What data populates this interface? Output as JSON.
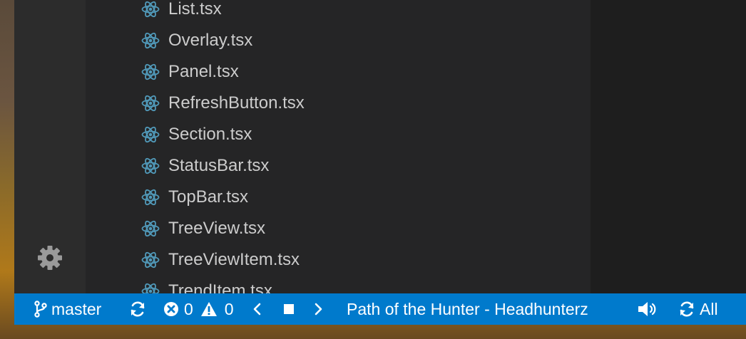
{
  "files": [
    {
      "name": "List.tsx"
    },
    {
      "name": "Overlay.tsx"
    },
    {
      "name": "Panel.tsx"
    },
    {
      "name": "RefreshButton.tsx"
    },
    {
      "name": "Section.tsx"
    },
    {
      "name": "StatusBar.tsx"
    },
    {
      "name": "TopBar.tsx"
    },
    {
      "name": "TreeView.tsx"
    },
    {
      "name": "TreeViewItem.tsx"
    },
    {
      "name": "TrendItem.tsx"
    }
  ],
  "status_bar": {
    "branch": "master",
    "errors": "0",
    "warnings": "0",
    "track": "Path of the Hunter - Headhunterz",
    "sync_label": "All"
  },
  "icons": {
    "file": "react-icon",
    "settings": "gear-icon",
    "branch": "git-branch-icon",
    "sync": "sync-icon",
    "errors": "error-icon",
    "warnings": "warning-icon",
    "prev": "chevron-left-icon",
    "stop": "stop-icon",
    "next": "chevron-right-icon",
    "volume": "volume-icon",
    "sync_all": "sync-all-icon"
  },
  "colors": {
    "status_bar": "#007acc",
    "sidebar": "#252526",
    "activity_bar": "#2c2c2c",
    "file_text": "#cccccc",
    "react_icon": "#519aba"
  }
}
